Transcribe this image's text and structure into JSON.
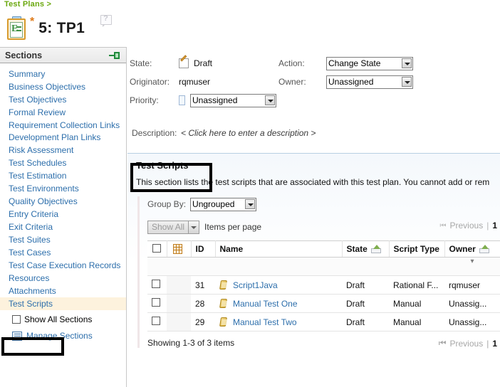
{
  "breadcrumb": "Test Plans >",
  "header": {
    "doc_icon": "clipboard-icon",
    "dirty_marker": "*",
    "title": "5: TP1",
    "help_icon": "help-question-icon"
  },
  "sidebar": {
    "heading": "Sections",
    "pin_icon": "pin-icon",
    "items": [
      {
        "label": "Summary",
        "selected": false
      },
      {
        "label": "Business Objectives",
        "selected": false
      },
      {
        "label": "Test Objectives",
        "selected": false
      },
      {
        "label": "Formal Review",
        "selected": false
      },
      {
        "label": "Requirement Collection Links",
        "selected": false
      },
      {
        "label": "Development Plan Links",
        "selected": false
      },
      {
        "label": "Risk Assessment",
        "selected": false
      },
      {
        "label": "Test Schedules",
        "selected": false
      },
      {
        "label": "Test Estimation",
        "selected": false
      },
      {
        "label": "Test Environments",
        "selected": false
      },
      {
        "label": "Quality Objectives",
        "selected": false
      },
      {
        "label": "Entry Criteria",
        "selected": false
      },
      {
        "label": "Exit Criteria",
        "selected": false
      },
      {
        "label": "Test Suites",
        "selected": false
      },
      {
        "label": "Test Cases",
        "selected": false
      },
      {
        "label": "Test Case Execution Records",
        "selected": false
      },
      {
        "label": "Resources",
        "selected": false
      },
      {
        "label": "Attachments",
        "selected": false
      },
      {
        "label": "Test Scripts",
        "selected": true
      }
    ],
    "show_all_sections": "Show All Sections",
    "manage_sections": "Manage Sections",
    "manage_icon": "list-icon"
  },
  "fields": {
    "state_label": "State:",
    "state_value": "Draft",
    "state_icon": "draft-pencil-icon",
    "originator_label": "Originator:",
    "originator_value": "rqmuser",
    "priority_label": "Priority:",
    "priority_icon": "priority-bar-icon",
    "priority_value": "Unassigned",
    "priority_options": [
      "Unassigned"
    ],
    "action_label": "Action:",
    "action_value": "Change State",
    "action_options": [
      "Change State"
    ],
    "owner_label": "Owner:",
    "owner_value": "Unassigned",
    "owner_options": [
      "Unassigned"
    ],
    "description_label": "Description:",
    "description_placeholder": "< Click here to enter a description >"
  },
  "section": {
    "title": "Test Scripts",
    "description": "This section lists the test scripts that are associated with this test plan. You cannot add or rem",
    "group_by_label": "Group By:",
    "group_by_value": "Ungrouped",
    "group_by_options": [
      "Ungrouped"
    ],
    "show_all_button": "Show All",
    "items_per_page_label": "Items per page",
    "pager": {
      "first_icon": "first-page-icon",
      "previous": "Previous",
      "separator": "|",
      "page": "1"
    },
    "showing_text": "Showing 1-3 of 3 items"
  },
  "table": {
    "columns": [
      {
        "key": "checkbox",
        "label": "",
        "icon": "checkbox-icon"
      },
      {
        "key": "typeicon",
        "label": "",
        "icon": "table-grid-icon"
      },
      {
        "key": "id",
        "label": "ID",
        "icon": null
      },
      {
        "key": "name",
        "label": "Name",
        "icon": null
      },
      {
        "key": "state",
        "label": "State",
        "icon": "sort-filter-icon"
      },
      {
        "key": "script_type",
        "label": "Script Type",
        "icon": null
      },
      {
        "key": "owner",
        "label": "Owner",
        "icon": "sort-filter-icon"
      }
    ],
    "rows": [
      {
        "id": "31",
        "name": "Script1Java",
        "state": "Draft",
        "script_type": "Rational F...",
        "owner": "rqmuser",
        "icon": "script-icon"
      },
      {
        "id": "28",
        "name": "Manual Test One",
        "state": "Draft",
        "script_type": "Manual",
        "owner": "Unassig...",
        "icon": "script-icon"
      },
      {
        "id": "29",
        "name": "Manual Test Two",
        "state": "Draft",
        "script_type": "Manual",
        "owner": "Unassig...",
        "icon": "script-icon"
      }
    ]
  },
  "colors": {
    "breadcrumb_green": "#6aa80e",
    "link_blue": "#2c6eab",
    "selected_row": "#fdf2dd",
    "annotation_black": "#000000",
    "accent_orange": "#e07b1a"
  }
}
